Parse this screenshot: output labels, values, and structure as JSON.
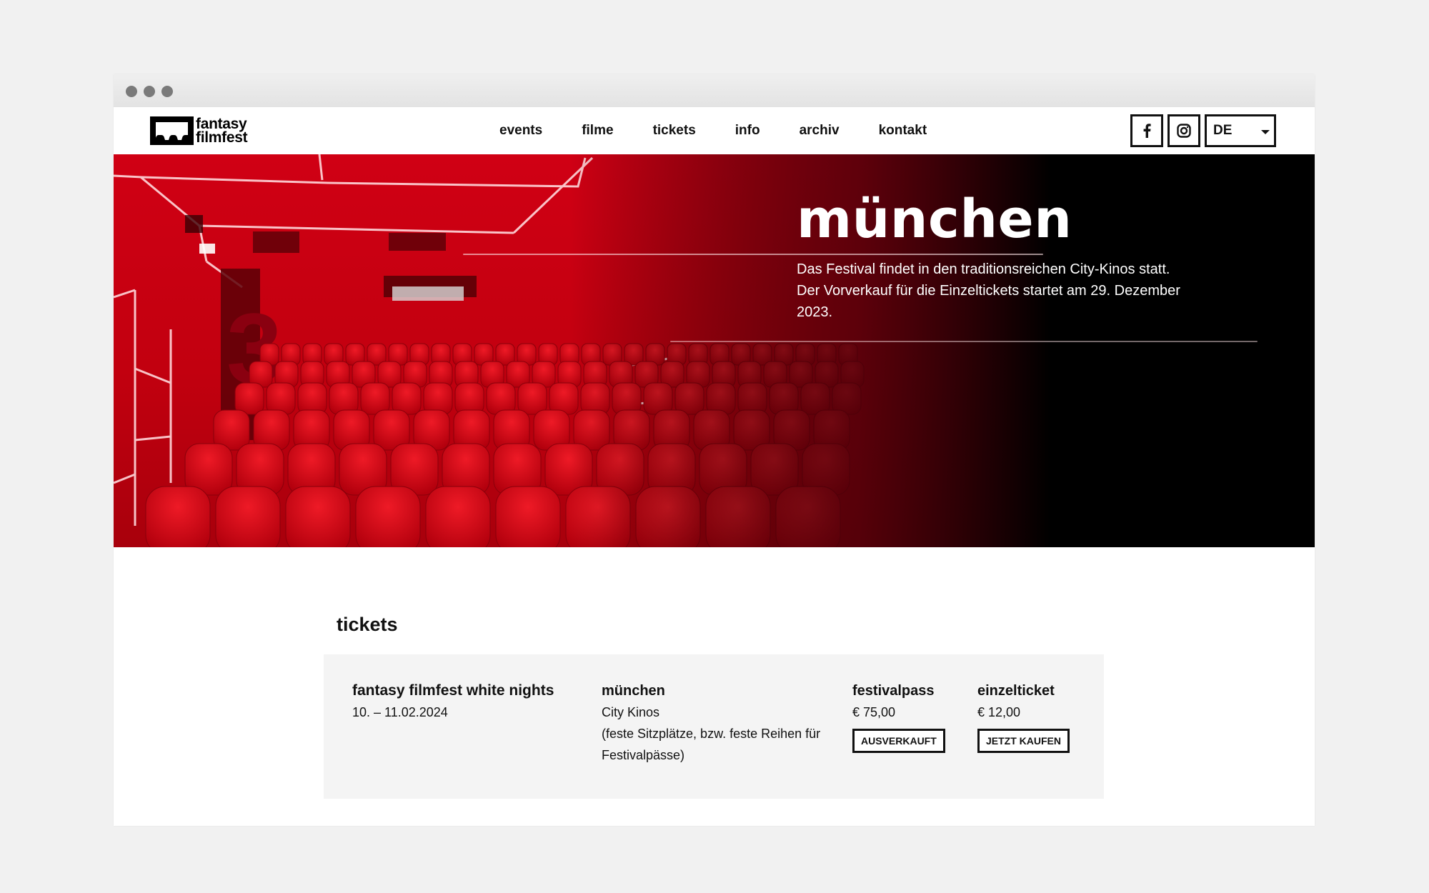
{
  "browser": {
    "controls": [
      "close",
      "minimize",
      "maximize"
    ]
  },
  "header": {
    "logo": {
      "line1": "fantasy",
      "line2": "filmfest"
    },
    "nav": [
      {
        "label": "events"
      },
      {
        "label": "filme"
      },
      {
        "label": "tickets"
      },
      {
        "label": "info"
      },
      {
        "label": "archiv"
      },
      {
        "label": "kontakt"
      }
    ],
    "social": [
      {
        "icon": "facebook-icon",
        "glyph": "f"
      },
      {
        "icon": "instagram-icon"
      }
    ],
    "language": {
      "selected": "DE"
    }
  },
  "hero": {
    "title": "münchen",
    "text_lines": [
      "Das Festival findet in den traditionsreichen City-Kinos statt.",
      "Der Vorverkauf für die Einzeltickets startet am 29. Dezember 2023."
    ],
    "colors": {
      "accent_red": "#c8001a",
      "dark": "#000000"
    }
  },
  "tickets": {
    "title": "tickets",
    "event": {
      "name": "fantasy filmfest white nights",
      "dates": "10. – 11.02.2024"
    },
    "venue": {
      "city": "münchen",
      "cinema": "City Kinos",
      "note": "(feste Sitzplätze, bzw. feste Reihen für Festivalpässe)"
    },
    "offers": [
      {
        "type": "festivalpass",
        "price": "€ 75,00",
        "button": "AUSVERKAUFT"
      },
      {
        "type": "einzelticket",
        "price": "€ 12,00",
        "button": "JETZT KAUFEN"
      }
    ]
  }
}
